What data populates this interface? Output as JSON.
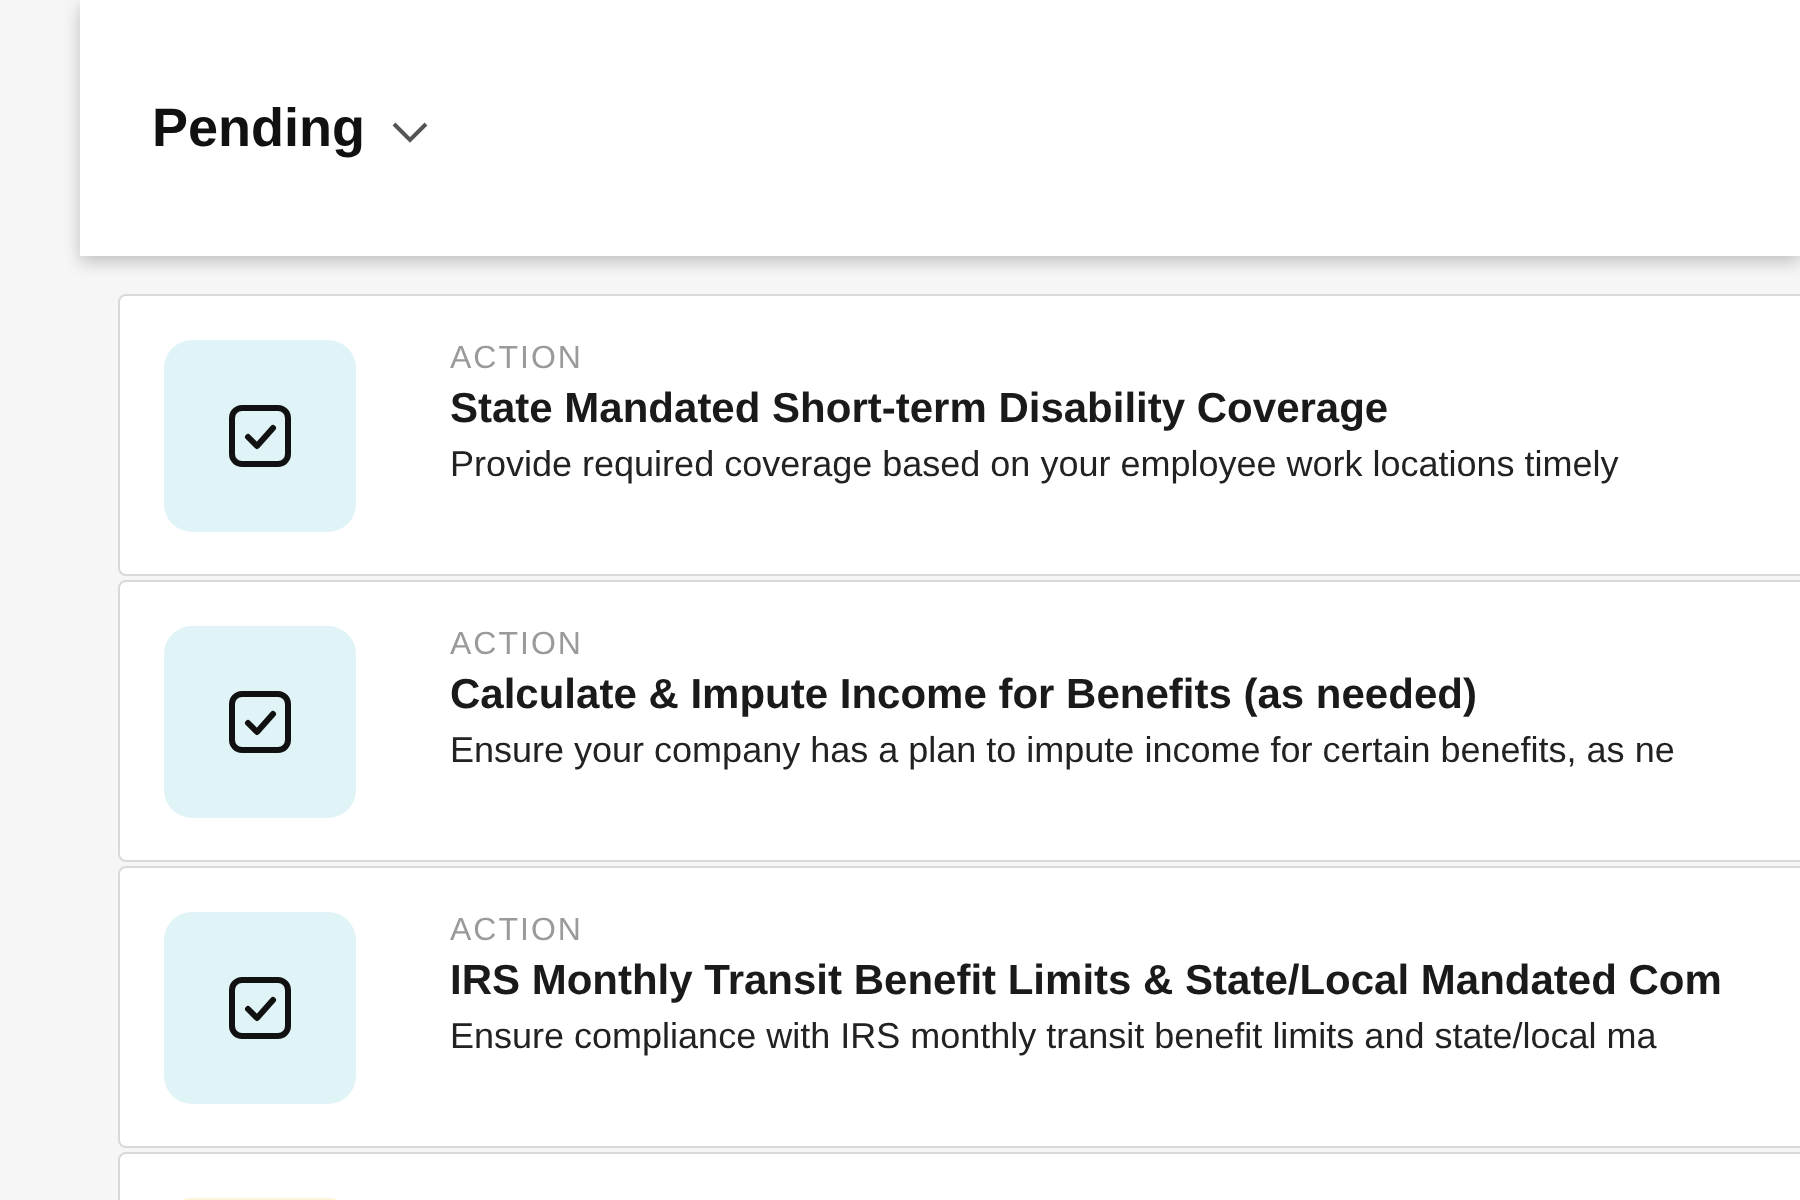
{
  "header": {
    "title": "Pending"
  },
  "items": [
    {
      "label": "ACTION",
      "title": "State Mandated Short-term Disability Coverage",
      "description": "Provide required coverage based on your employee work locations timely",
      "color": "#e0f3f6"
    },
    {
      "label": "ACTION",
      "title": "Calculate & Impute Income for Benefits (as needed)",
      "description": "Ensure your company has a plan to impute income for certain benefits, as ne",
      "color": "#e0f3f6"
    },
    {
      "label": "ACTION",
      "title": "IRS Monthly Transit Benefit Limits & State/Local Mandated Com",
      "description": "Ensure compliance with IRS monthly transit benefit limits and state/local ma",
      "color": "#e0f3f6"
    },
    {
      "color": "#fbf5d9"
    }
  ]
}
